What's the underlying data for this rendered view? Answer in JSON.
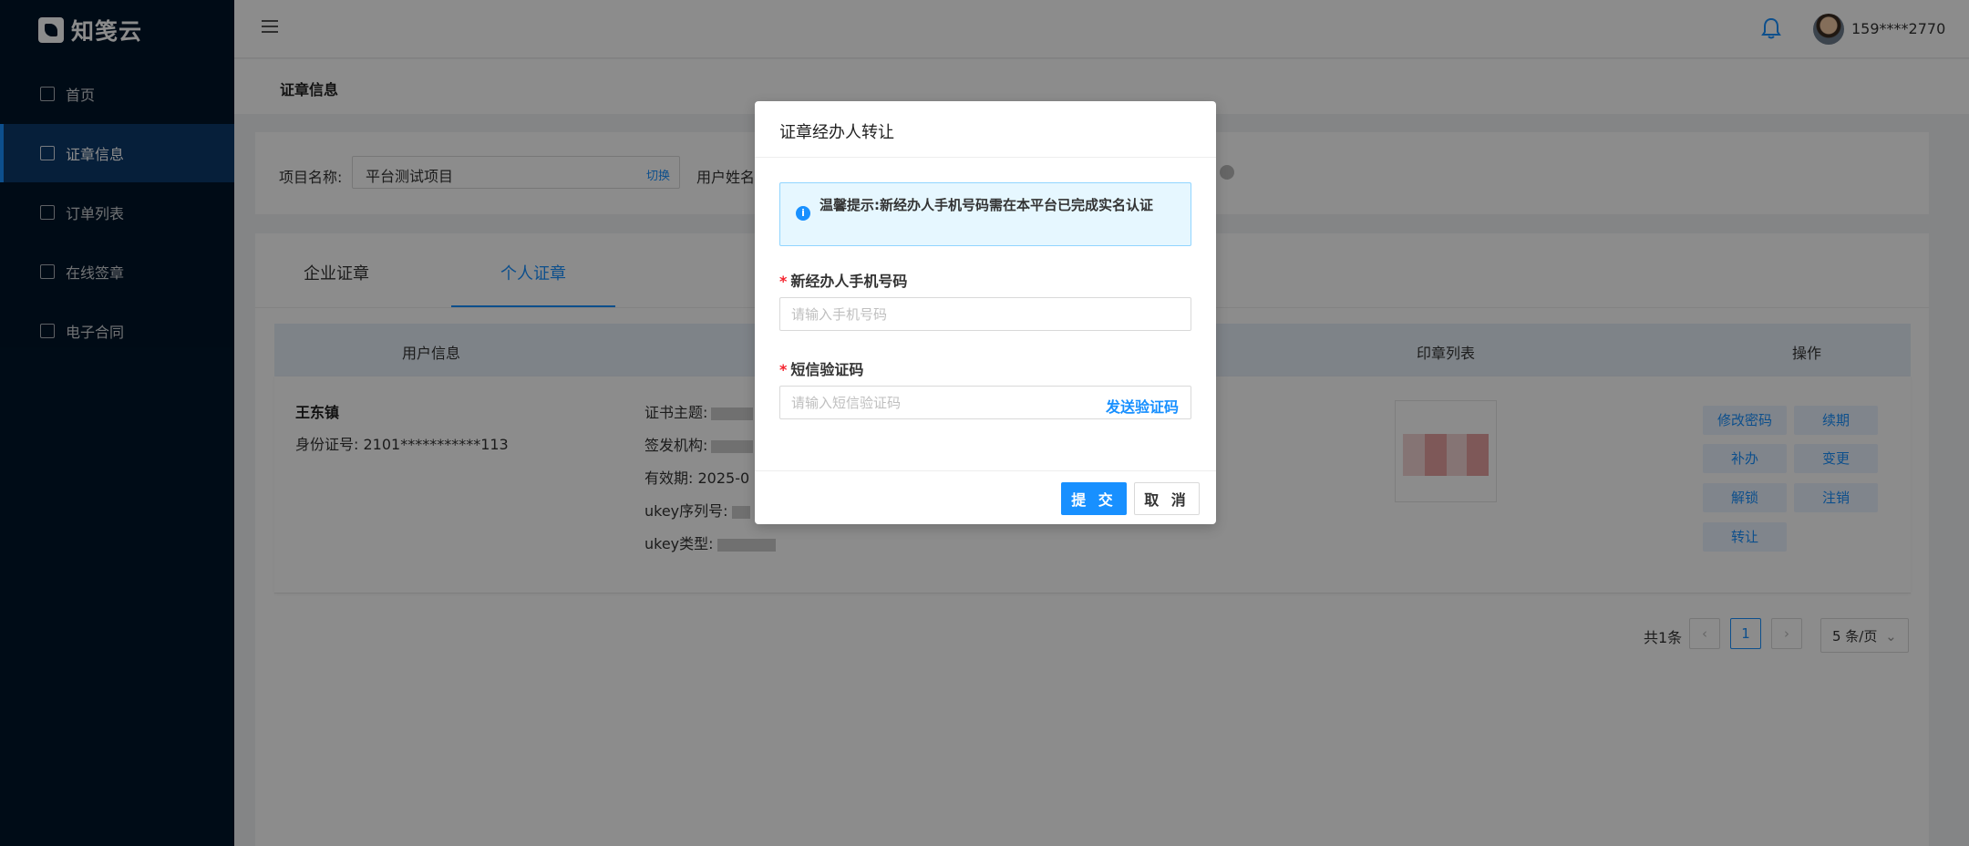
{
  "app": {
    "logo_text": "知笺云"
  },
  "sidebar": {
    "items": [
      {
        "label": "首页",
        "icon": "home-icon"
      },
      {
        "label": "证章信息",
        "icon": "certificate-icon"
      },
      {
        "label": "订单列表",
        "icon": "order-list-icon"
      },
      {
        "label": "在线签章",
        "icon": "sign-icon"
      },
      {
        "label": "电子合同",
        "icon": "contract-icon"
      }
    ],
    "active_index": 1
  },
  "header": {
    "username": "159****2770"
  },
  "breadcrumb": {
    "title": "证章信息"
  },
  "project": {
    "label": "项目名称:",
    "value": "平台测试项目",
    "switch_label": "切换",
    "user_name_label": "用户姓名"
  },
  "tabs": [
    {
      "label": "企业证章"
    },
    {
      "label": "个人证章"
    }
  ],
  "table": {
    "headers": [
      "用户信息",
      "印章列表",
      "操作"
    ],
    "row": {
      "user_name": "王东镇",
      "id_number": "身份证号: 2101***********113",
      "cert_subject": "证书主题:",
      "cert_issuer": "签发机构:",
      "cert_validity": "有效期: 2025-0",
      "ukey_serial": "ukey序列号:",
      "ukey_type": "ukey类型:"
    },
    "actions": [
      "修改密码",
      "续期",
      "补办",
      "变更",
      "解锁",
      "注销",
      "转让"
    ]
  },
  "pagination": {
    "total": "共1条",
    "current": "1",
    "page_size": "5 条/页"
  },
  "modal": {
    "title": "证章经办人转让",
    "tip": "温馨提示:新经办人手机号码需在本平台已完成实名认证",
    "phone_label": "新经办人手机号码",
    "phone_placeholder": "请输入手机号码",
    "sms_label": "短信验证码",
    "sms_placeholder": "请输入短信验证码",
    "send_code": "发送验证码",
    "submit": "提 交",
    "cancel": "取 消"
  },
  "colors": {
    "primary": "#1890ff",
    "sidebar_bg": "#001529",
    "required": "#f5222d"
  }
}
